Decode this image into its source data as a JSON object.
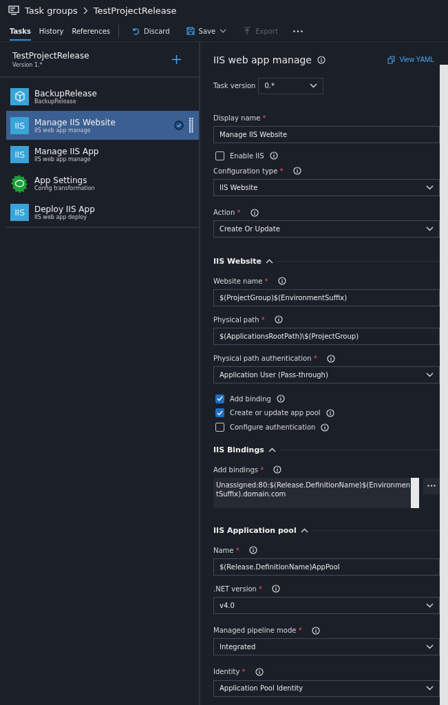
{
  "header": {
    "breadcrumb": [
      "Task groups",
      "TestProjectRelease"
    ]
  },
  "tabs": [
    {
      "label": "Tasks",
      "selected": true
    },
    {
      "label": "History",
      "selected": false
    },
    {
      "label": "References",
      "selected": false
    }
  ],
  "toolbar": [
    {
      "kind": "discard",
      "label": "Discard",
      "disabled": false
    },
    {
      "kind": "save",
      "label": "Save",
      "disabled": false
    },
    {
      "kind": "export",
      "label": "Export",
      "disabled": true
    }
  ],
  "group": {
    "name": "TestProjectRelease",
    "version": "Version 1.*"
  },
  "tasks": [
    {
      "title": "BackupRelease",
      "subtitle": "BackupRelease",
      "kind": "package",
      "selected": false
    },
    {
      "title": "Manage IIS Website",
      "subtitle": "IIS web app manage",
      "kind": "iis",
      "icon_text": "IIS",
      "selected": true
    },
    {
      "title": "Manage IIS App",
      "subtitle": "IIS web app manage",
      "kind": "iis",
      "icon_text": "IIS",
      "selected": false
    },
    {
      "title": "App Settings",
      "subtitle": "Config transformation",
      "kind": "gear",
      "selected": false
    },
    {
      "title": "Deploy IIS App",
      "subtitle": "IIS web app deploy",
      "kind": "iis",
      "icon_text": "IIS",
      "selected": false
    }
  ],
  "detail": {
    "title": "IIS web app manage",
    "view_yaml": "View YAML",
    "task_version_label": "Task version",
    "task_version": "0.*",
    "required_mark": "*",
    "fields": [
      {
        "kind": "text",
        "label": "Display name",
        "required": true,
        "info": false,
        "value": "Manage IIS Website"
      },
      {
        "kind": "checkbox",
        "label": "Enable IIS",
        "checked": false
      },
      {
        "kind": "select",
        "label": "Configuration type",
        "required": true,
        "info": true,
        "value": "IIS Website"
      },
      {
        "kind": "select",
        "label": "Action",
        "required": true,
        "info": true,
        "value": "Create Or Update"
      },
      {
        "kind": "section",
        "label": "IIS Website",
        "expanded": true
      },
      {
        "kind": "text",
        "label": "Website name",
        "required": true,
        "info": true,
        "value": "$(ProjectGroup)$(EnvironmentSuffix)"
      },
      {
        "kind": "text",
        "label": "Physical path",
        "required": true,
        "info": true,
        "value": "$(ApplicationsRootPath)\\$(ProjectGroup)"
      },
      {
        "kind": "select",
        "label": "Physical path authentication",
        "required": true,
        "info": true,
        "value": "Application User (Pass-through)"
      },
      {
        "kind": "checkbox",
        "label": "Add binding",
        "checked": true
      },
      {
        "kind": "checkbox",
        "label": "Create or update app pool",
        "checked": true
      },
      {
        "kind": "checkbox",
        "label": "Configure authentication",
        "checked": false
      },
      {
        "kind": "section",
        "label": "IIS Bindings",
        "expanded": true
      },
      {
        "kind": "textarea",
        "label": "Add bindings",
        "required": true,
        "info": true,
        "value": "Unassigned:80:$(Release.DefinitionName)$(EnvironmentSuffix).domain.com"
      },
      {
        "kind": "section",
        "label": "IIS Application pool",
        "expanded": true
      },
      {
        "kind": "text",
        "label": "Name",
        "required": true,
        "info": true,
        "value": "$(Release.DefinitionName)AppPool"
      },
      {
        "kind": "select",
        "label": ".NET version",
        "required": true,
        "info": true,
        "value": "v4.0"
      },
      {
        "kind": "select",
        "label": "Managed pipeline mode",
        "required": true,
        "info": true,
        "value": "Integrated"
      },
      {
        "kind": "select",
        "label": "Identity",
        "required": true,
        "info": true,
        "value": "Application Pool Identity"
      }
    ]
  }
}
